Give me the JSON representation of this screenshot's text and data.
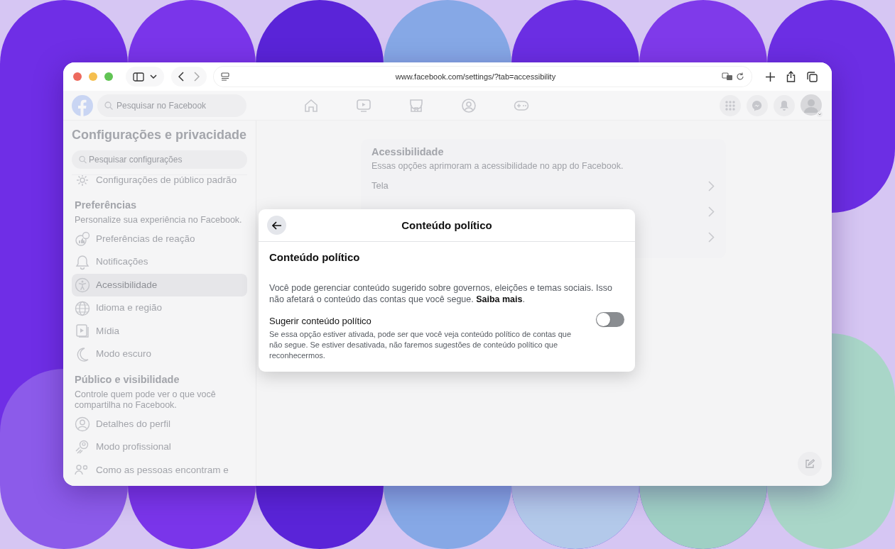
{
  "browser": {
    "url": "www.facebook.com/settings/?tab=accessibility"
  },
  "facebook_header": {
    "search_placeholder": "Pesquisar no Facebook"
  },
  "sidebar": {
    "title": "Configurações e privacidade",
    "search_placeholder": "Pesquisar configurações",
    "sections": [
      {
        "items": [
          {
            "label": "Configurações de público padrão",
            "kind": "gear",
            "selected": false
          }
        ]
      },
      {
        "heading": "Preferências",
        "description": "Personalize sua experiência no Facebook.",
        "items": [
          {
            "label": "Preferências de reação",
            "kind": "reaction",
            "selected": false
          },
          {
            "label": "Notificações",
            "kind": "bell",
            "selected": false
          },
          {
            "label": "Acessibilidade",
            "kind": "accessibility",
            "selected": true
          },
          {
            "label": "Idioma e região",
            "kind": "globe",
            "selected": false
          },
          {
            "label": "Mídia",
            "kind": "media",
            "selected": false
          },
          {
            "label": "Modo escuro",
            "kind": "moon",
            "selected": false
          }
        ]
      },
      {
        "heading": "Público e visibilidade",
        "description": "Controle quem pode ver o que você compartilha no Facebook.",
        "items": [
          {
            "label": "Detalhes do perfil",
            "kind": "person",
            "selected": false
          },
          {
            "label": "Modo profissional",
            "kind": "rocket",
            "selected": false
          },
          {
            "label": "Como as pessoas encontram e",
            "kind": "people",
            "selected": false
          }
        ]
      }
    ]
  },
  "main_card": {
    "title": "Acessibilidade",
    "description": "Essas opções aprimoram a acessibilidade no app do Facebook.",
    "rows": [
      {
        "kind": "labeled",
        "label": "Tela"
      },
      {
        "kind": "covered"
      },
      {
        "kind": "covered"
      }
    ]
  },
  "dialog": {
    "title": "Conteúdo político",
    "heading": "Conteúdo político",
    "description": "Você pode gerenciar conteúdo sugerido sobre governos, eleições e temas sociais. Isso não afetará o conteúdo das contas que você segue.",
    "link": "Saiba mais",
    "after_link": ".",
    "setting": {
      "label": "Sugerir conteúdo político",
      "description": "Se essa opção estiver ativada, pode ser que você veja conteúdo político de contas que não segue. Se estiver desativada, não faremos sugestões de conteúdo político que reconhecermos.",
      "on": false
    }
  }
}
